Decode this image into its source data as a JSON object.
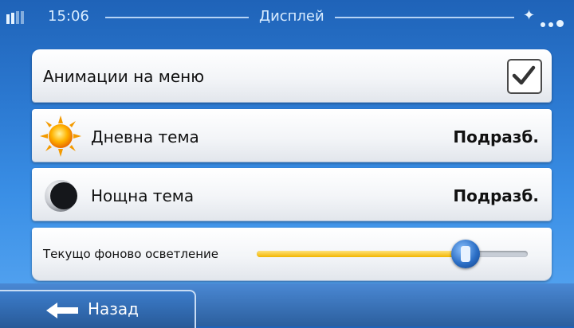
{
  "status_bar": {
    "time": "15:06",
    "title": "Дисплей",
    "gps_icon": "satellite-icon",
    "signal_icon": "signal-bars-icon"
  },
  "settings": {
    "menu_animations": {
      "label": "Анимации на меню",
      "checked": true
    },
    "day_theme": {
      "label": "Дневна тема",
      "value": "Подразб.",
      "icon": "sun-icon"
    },
    "night_theme": {
      "label": "Нощна тема",
      "value": "Подразб.",
      "icon": "moon-icon"
    },
    "backlight": {
      "label": "Текущо фоново осветление",
      "level": 0.77
    }
  },
  "footer": {
    "back_label": "Назад",
    "back_icon": "arrow-left-icon"
  },
  "colors": {
    "background": "#2b78d0",
    "slider_fill": "#f2b600",
    "knob": "#2c6fc6"
  }
}
